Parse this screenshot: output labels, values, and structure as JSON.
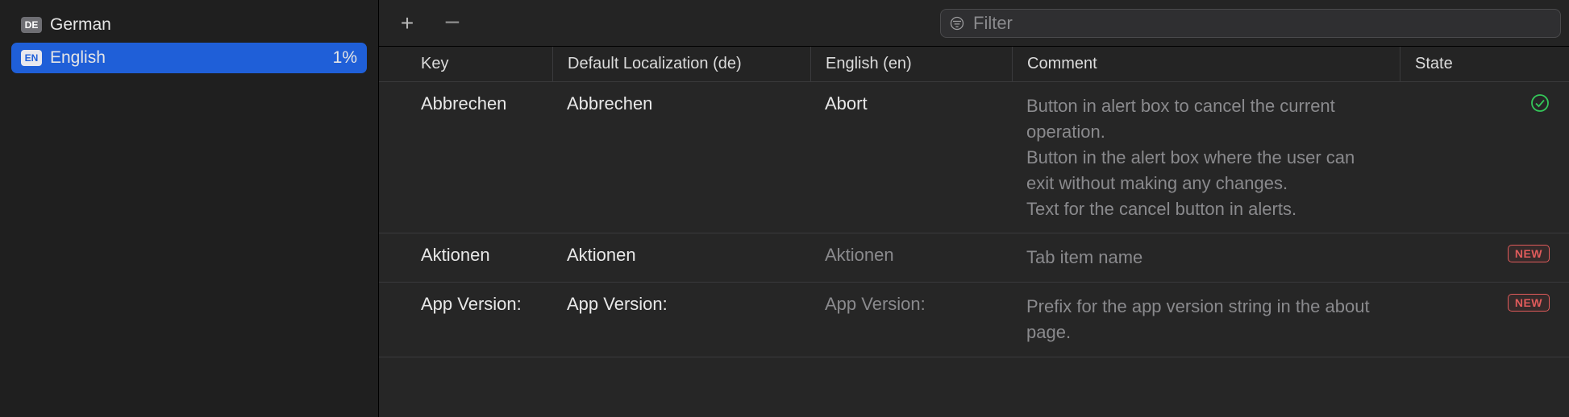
{
  "sidebar": {
    "items": [
      {
        "badge": "DE",
        "name": "German",
        "pct": "",
        "selected": false
      },
      {
        "badge": "EN",
        "name": "English",
        "pct": "1%",
        "selected": true
      }
    ]
  },
  "toolbar": {
    "add_label": "+",
    "remove_label": "−",
    "filter_placeholder": "Filter"
  },
  "table": {
    "headers": {
      "key": "Key",
      "default": "Default Localization (de)",
      "english": "English (en)",
      "comment": "Comment",
      "state": "State"
    },
    "rows": [
      {
        "key": "Abbrechen",
        "default": "Abbrechen",
        "english": "Abort",
        "english_placeholder": false,
        "comment": "Button in alert box to cancel the current operation.\nButton in the alert box where the user can exit without making any changes.\nText for the cancel button in alerts.",
        "state": "ok"
      },
      {
        "key": "Aktionen",
        "default": "Aktionen",
        "english": "Aktionen",
        "english_placeholder": true,
        "comment": "Tab item name",
        "state": "new"
      },
      {
        "key": "App Version:",
        "default": "App Version:",
        "english": "App Version:",
        "english_placeholder": true,
        "comment": "Prefix for the app version string in the about page.",
        "state": "new"
      }
    ],
    "state_labels": {
      "new": "NEW"
    }
  }
}
